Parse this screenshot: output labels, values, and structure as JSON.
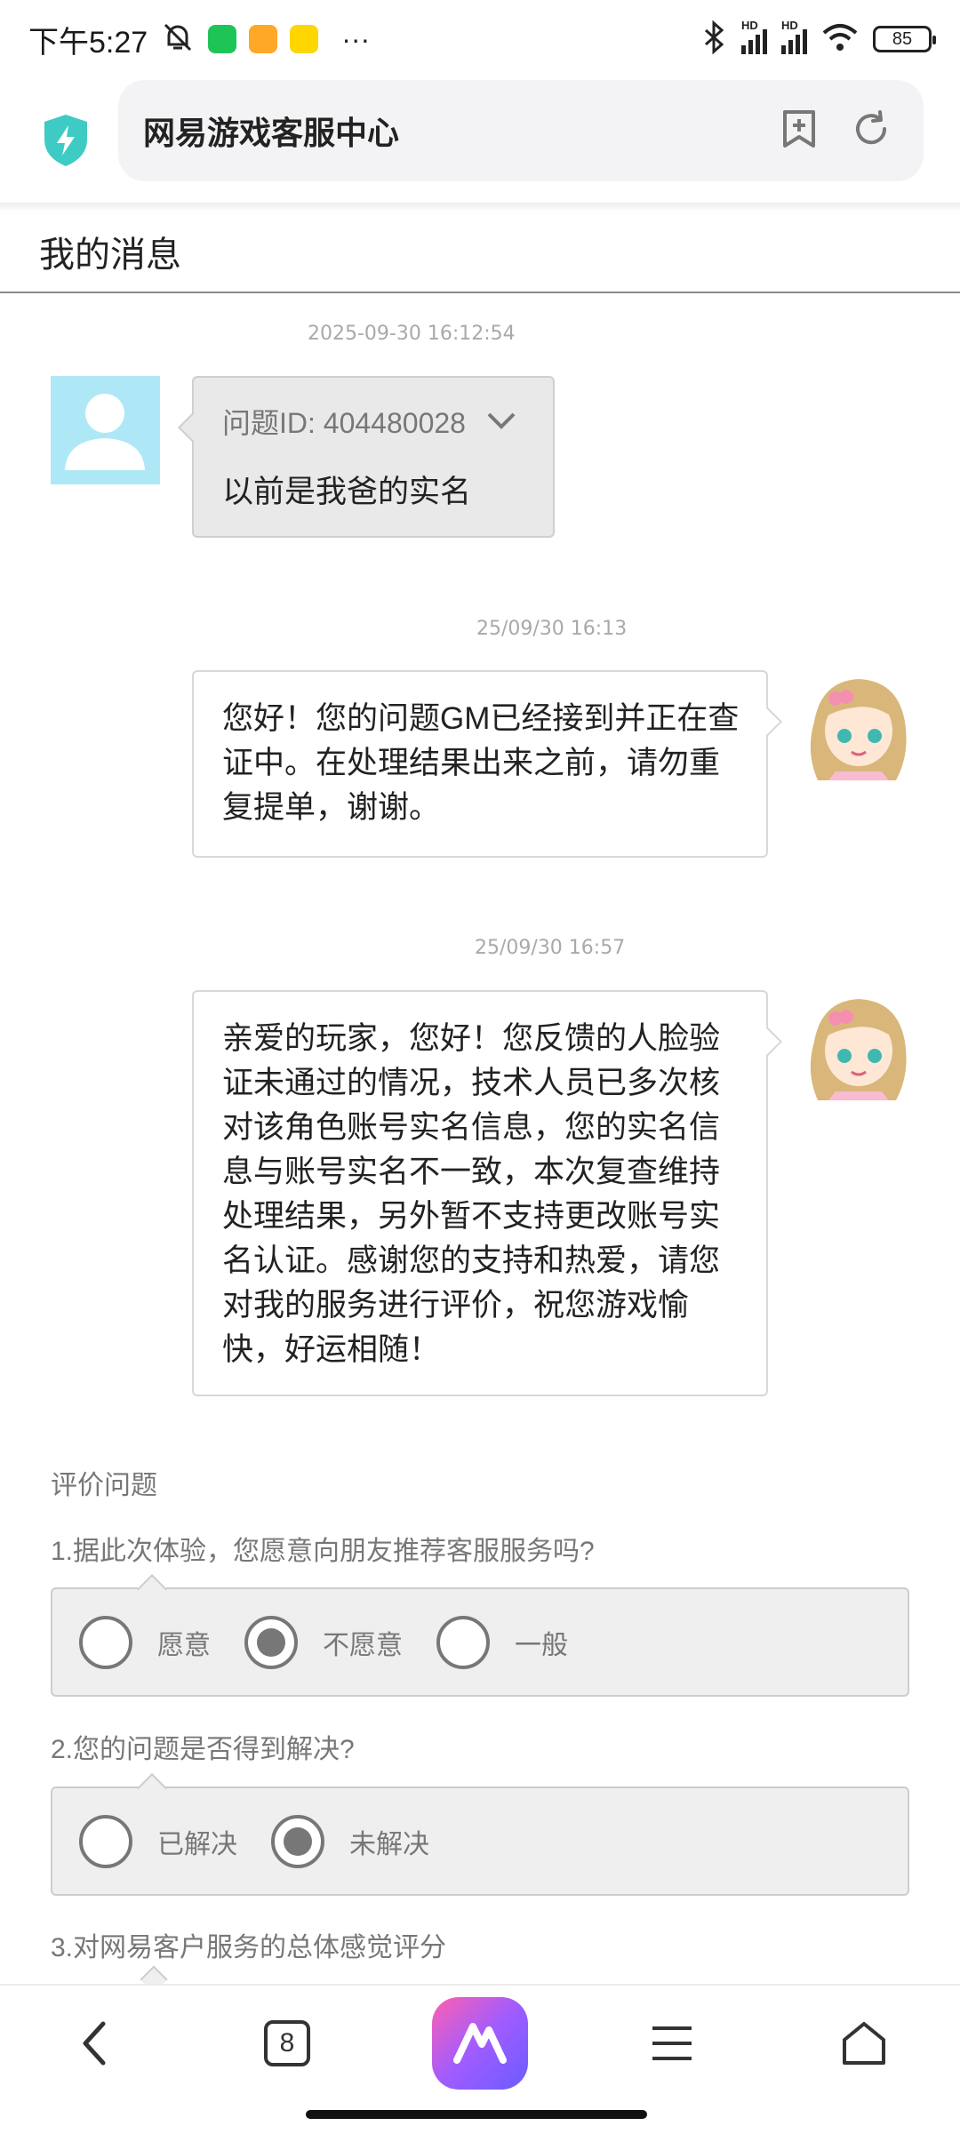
{
  "status_bar": {
    "time": "下午5:27",
    "battery": "85",
    "icons": [
      "mute-bell-icon",
      "wechat-icon",
      "note-app-icon",
      "game-app-icon",
      "more-dots-icon",
      "bluetooth-icon",
      "signal-hd-icon",
      "signal-hd-icon",
      "wifi-icon",
      "battery-icon"
    ],
    "more_dots": "···",
    "hd_label": "HD"
  },
  "address_bar": {
    "title": "网易游戏客服中心",
    "icons": [
      "shield-bolt-icon",
      "add-bookmark-icon",
      "refresh-icon"
    ]
  },
  "page": {
    "title": "我的消息"
  },
  "messages": [
    {
      "sender": "user",
      "timestamp": "2025-09-30 16:12:54",
      "question_id_label": "问题ID: 404480028",
      "text": "以前是我爸的实名"
    },
    {
      "sender": "gm",
      "timestamp": "25/09/30 16:13",
      "text": "您好！您的问题GM已经接到并正在查证中。在处理结果出来之前，请勿重复提单，谢谢。"
    },
    {
      "sender": "gm",
      "timestamp": "25/09/30 16:57",
      "text": "亲爱的玩家，您好！您反馈的人脸验证未通过的情况，技术人员已多次核对该角色账号实名信息，您的实名信息与账号实名不一致，本次复查维持处理结果，另外暂不支持更改账号实名认证。感谢您的支持和热爱，请您对我的服务进行评价，祝您游戏愉快，好运相随！"
    }
  ],
  "rating": {
    "section_title": "评价问题",
    "questions": [
      {
        "label": "1.据此次体验，您愿意向朋友推荐客服服务吗?",
        "options": [
          "愿意",
          "不愿意",
          "一般"
        ],
        "selected": "不愿意"
      },
      {
        "label": "2.您的问题是否得到解决?",
        "options": [
          "已解决",
          "未解决"
        ],
        "selected": "未解决"
      },
      {
        "label": "3.对网易客户服务的总体感觉评分"
      }
    ]
  },
  "bottom_nav": {
    "tab_count": "8",
    "icons": [
      "back-icon",
      "tabs-icon",
      "ai-assistant-icon",
      "menu-icon",
      "home-icon"
    ]
  },
  "colors": {
    "shield": "#3dcbc4",
    "ai_gradient_start": "#ff5fb0",
    "ai_gradient_end": "#6a5cff",
    "user_avatar_bg": "#aee8f7"
  }
}
